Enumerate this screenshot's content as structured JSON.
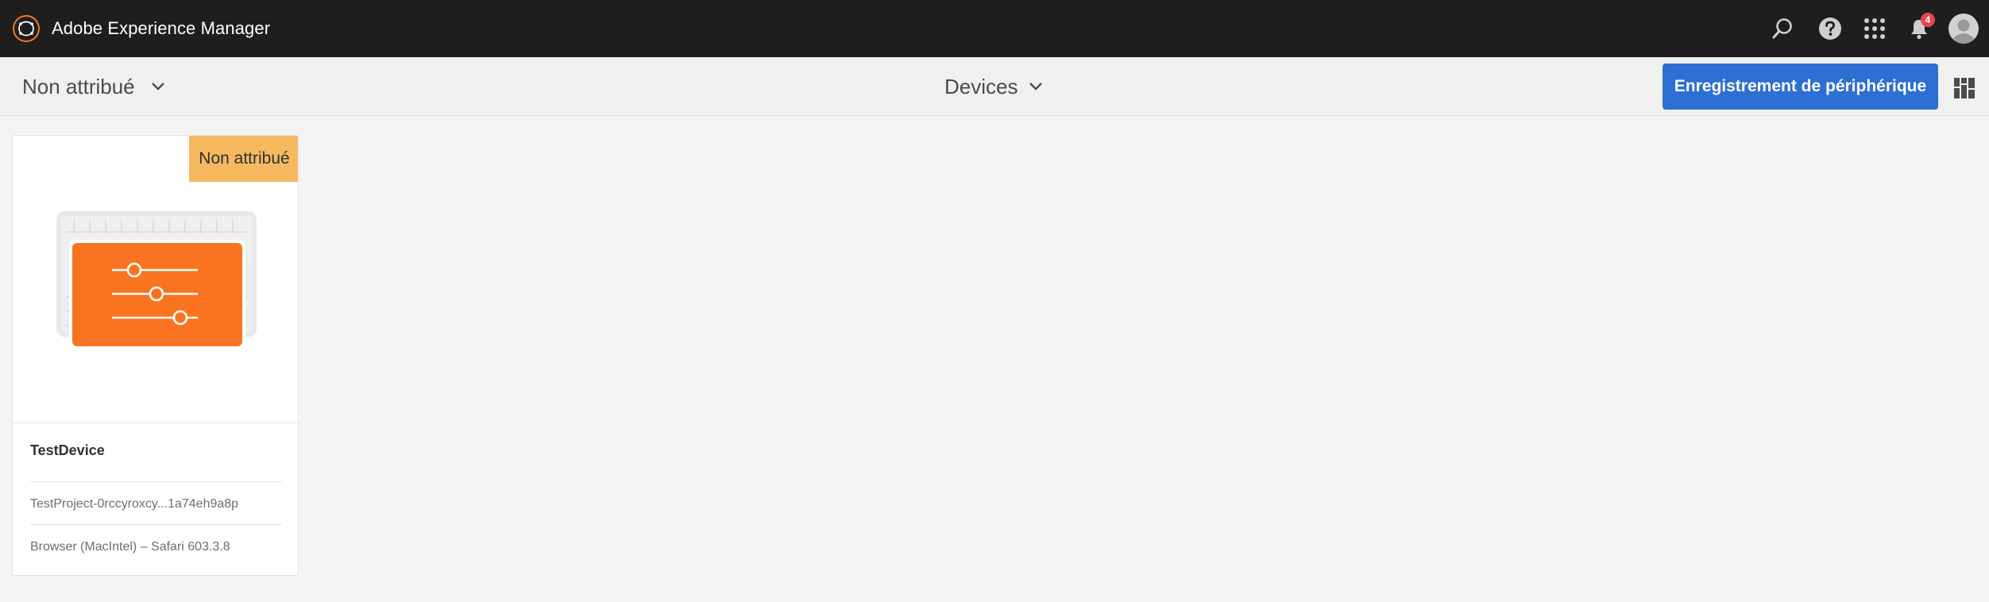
{
  "shell": {
    "app_title": "Adobe Experience Manager",
    "notification_count": "4",
    "icons": [
      "adobe-experience-manager-logo",
      "search-icon",
      "help-icon",
      "solutions-grid-icon",
      "bell-icon",
      "user-avatar"
    ]
  },
  "actionbar": {
    "filter_label": "Non attribué",
    "view_title": "Devices",
    "primary_button_label": "Enregistrement de périphérique"
  },
  "cards": [
    {
      "status_tag": "Non attribué",
      "title": "TestDevice",
      "meta_project": "TestProject-0rccyroxcy...1a74eh9a8p",
      "meta_browser": "Browser (MacIntel) – Safari 603.3.8"
    }
  ],
  "colors": {
    "shell_bg": "#1e1e1e",
    "accent_blue": "#2d6fd2",
    "status_tag": "#f6b960",
    "device_orange": "#fa7321",
    "badge_red": "#e34850"
  }
}
